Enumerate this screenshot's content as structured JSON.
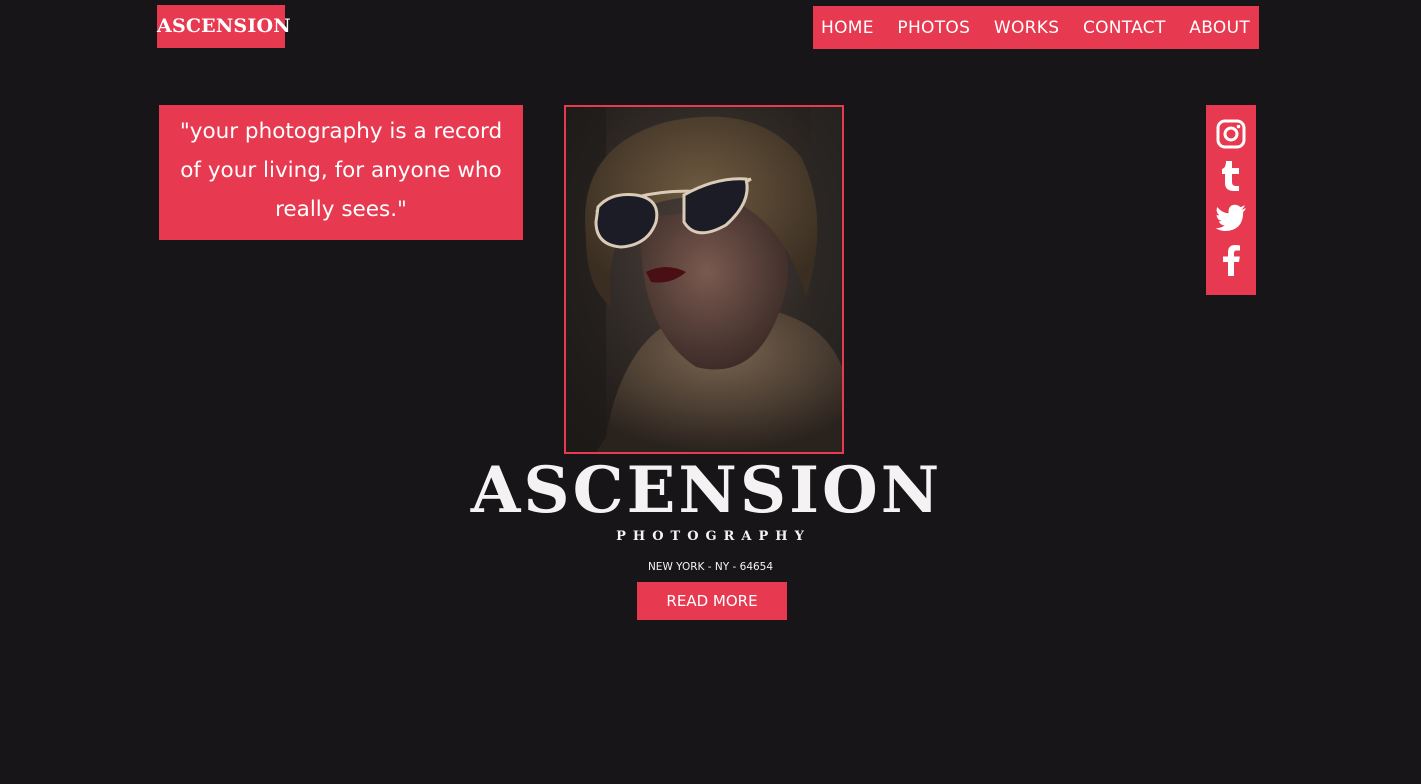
{
  "header": {
    "logo": "ASCENSION",
    "nav": [
      "HOME",
      "PHOTOS",
      "WORKS",
      "CONTACT",
      "ABOUT"
    ]
  },
  "quote": {
    "text": "\"your photography is a record of your living, for anyone who really sees.\""
  },
  "hero": {
    "image_icon": "portrait-photo",
    "title": "ASCENSION",
    "subtitle": "PHOTOGRAPHY",
    "address": "NEW YORK - NY - 64654",
    "cta_label": "READ MORE"
  },
  "social": {
    "icons": [
      "instagram-icon",
      "tumblr-icon",
      "twitter-icon",
      "facebook-icon"
    ]
  },
  "colors": {
    "background": "#171517",
    "accent": "#e73950",
    "text": "#ffffff"
  }
}
